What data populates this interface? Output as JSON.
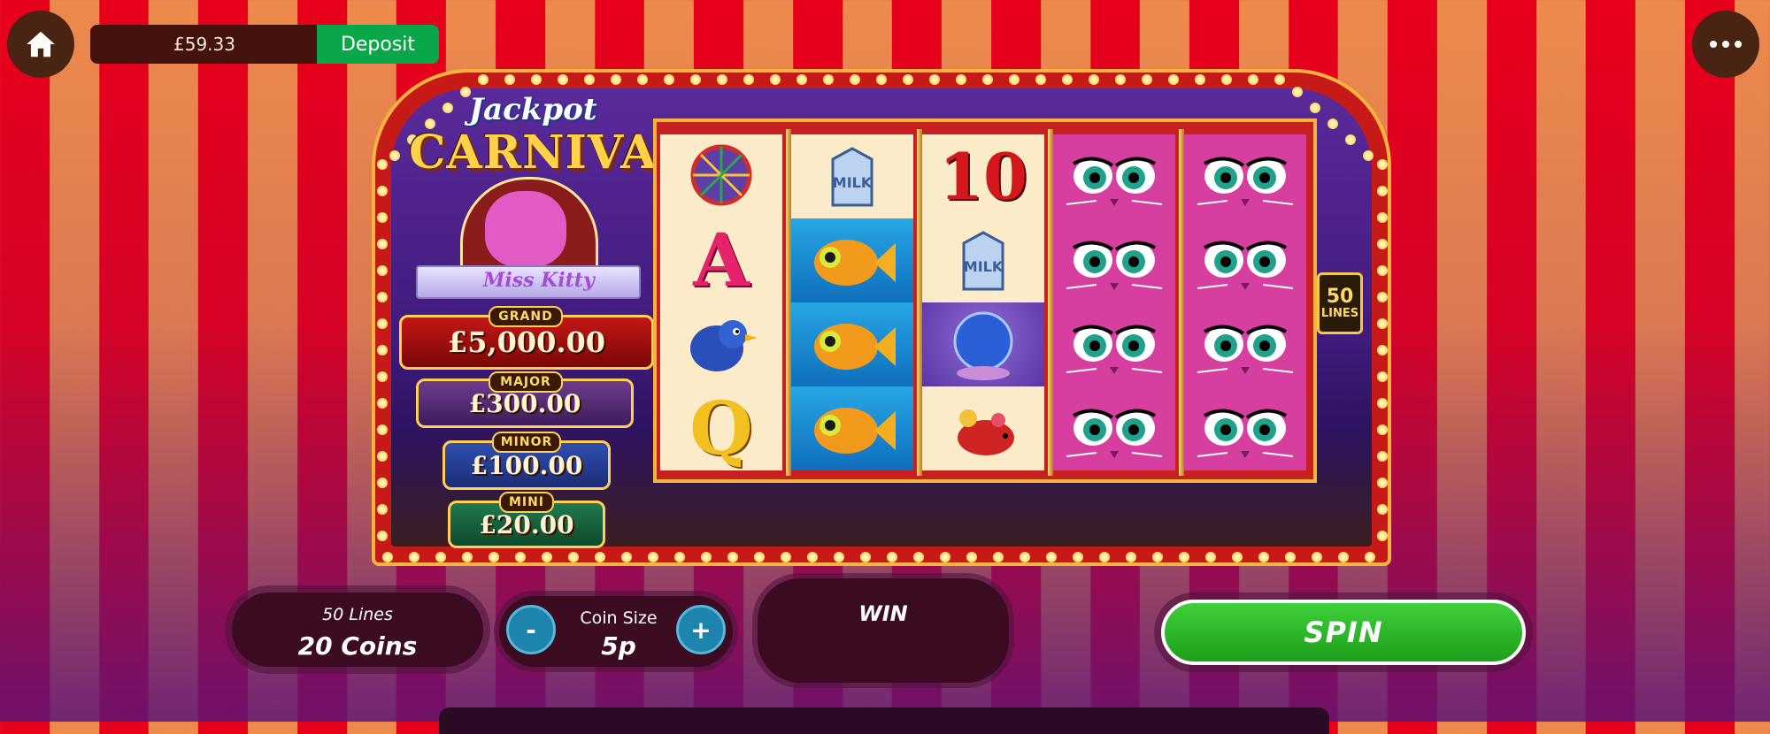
{
  "header": {
    "balance": "£59.33",
    "deposit_label": "Deposit",
    "home_icon": "home-icon",
    "menu_icon": "more-horizontal-icon"
  },
  "logo": {
    "line1": "Jackpot",
    "line2": "CARNIVAL",
    "subtitle": "Miss Kitty"
  },
  "jackpots": [
    {
      "tier": "GRAND",
      "amount": "£5,000.00"
    },
    {
      "tier": "MAJOR",
      "amount": "£300.00"
    },
    {
      "tier": "MINOR",
      "amount": "£100.00"
    },
    {
      "tier": "MINI",
      "amount": "£20.00"
    }
  ],
  "reels": [
    [
      "ferris-wheel",
      "A",
      "bluebird",
      "Q"
    ],
    [
      "milk-carton",
      "goldfish",
      "goldfish",
      "goldfish"
    ],
    [
      "10",
      "milk-carton",
      "crystal-ball",
      "wind-up-mouse"
    ],
    [
      "miss-kitty",
      "miss-kitty",
      "miss-kitty",
      "miss-kitty"
    ],
    [
      "miss-kitty",
      "miss-kitty",
      "miss-kitty",
      "miss-kitty"
    ]
  ],
  "lines_badge": {
    "number": "50",
    "label": "LINES"
  },
  "controls": {
    "lines_text": "50 Lines",
    "coins_text": "20 Coins",
    "coin_size_label": "Coin Size",
    "coin_size_value": "5p",
    "minus_label": "-",
    "plus_label": "+",
    "win_label": "WIN",
    "spin_label": "SPIN"
  },
  "colors": {
    "deposit": "#0aa64a",
    "spin": "#2db52a",
    "stripe_red": "#e8001a",
    "stripe_orange": "#ee8a4c"
  }
}
